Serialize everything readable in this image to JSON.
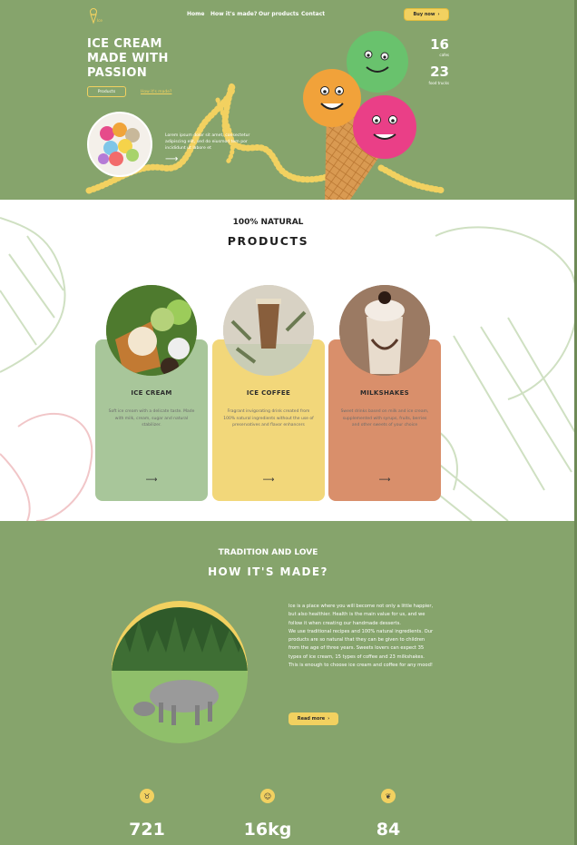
{
  "nav": {
    "logo_text": "Ice",
    "links": [
      "Home",
      "How it's made?",
      "Our products",
      "Contact"
    ],
    "buy_label": "Buy now"
  },
  "hero": {
    "title_line1": "ICE CREAM",
    "title_line2": "MADE WITH",
    "title_line3": "PASSION",
    "btn_products": "Products",
    "link_how": "How it's made?",
    "blurb": "Lorem ipsum dolor sit amet, consectetur adipiscing elit, sed do eiusmod tem por incididunt ut labore et",
    "arrow": "⟶",
    "stats": [
      {
        "value": "16",
        "label": "cafes"
      },
      {
        "value": "23",
        "label": "food trucks"
      }
    ]
  },
  "products": {
    "eyebrow": "100% NATURAL",
    "heading": "PRODUCTS",
    "cards": [
      {
        "title": "ICE CREAM",
        "desc": "Soft ice cream with a delicate taste. Made with milk, cream, sugar and natural stabilizer.",
        "arrow": "⟶",
        "color": "#a8c69a"
      },
      {
        "title": "ICE COFFEE",
        "desc": "Fragrant invigorating drink created from 100% natural ingredients without the use of preservatives and flavor enhancers",
        "arrow": "⟶",
        "color": "#f2d77a"
      },
      {
        "title": "MILKSHAKES",
        "desc": "Sweet drinks based on milk and ice cream, supplemented with syrups, fruits, berries and other sweets of your choice",
        "arrow": "⟶",
        "color": "#d98f6b"
      }
    ]
  },
  "how": {
    "eyebrow": "TRADITION AND LOVE",
    "heading": "HOW IT'S MADE?",
    "paragraphs": [
      "Ice is a place where you will become not only a little happier, but also healthier. Health is the main value for us, and we follow it when creating our handmade desserts.",
      "We use traditional recipes and 100% natural ingredients. Our products are so natural that they can be given to children from the age of three years. Sweets lovers can expect 35 types of ice cream, 15 types of coffee and 23 milkshakes.",
      "This is enough to choose ice cream and coffee for any mood!"
    ],
    "read_more": "Read more",
    "stats": [
      {
        "value": "721",
        "icon": "cow-icon"
      },
      {
        "value": "16kg",
        "icon": "smile-face-icon"
      },
      {
        "value": "84",
        "icon": "leaf-icon"
      }
    ]
  },
  "colors": {
    "green": "#86a46c",
    "yellow": "#f2d160",
    "card_green": "#a8c69a",
    "card_yellow": "#f2d77a",
    "card_orange": "#d98f6b"
  }
}
